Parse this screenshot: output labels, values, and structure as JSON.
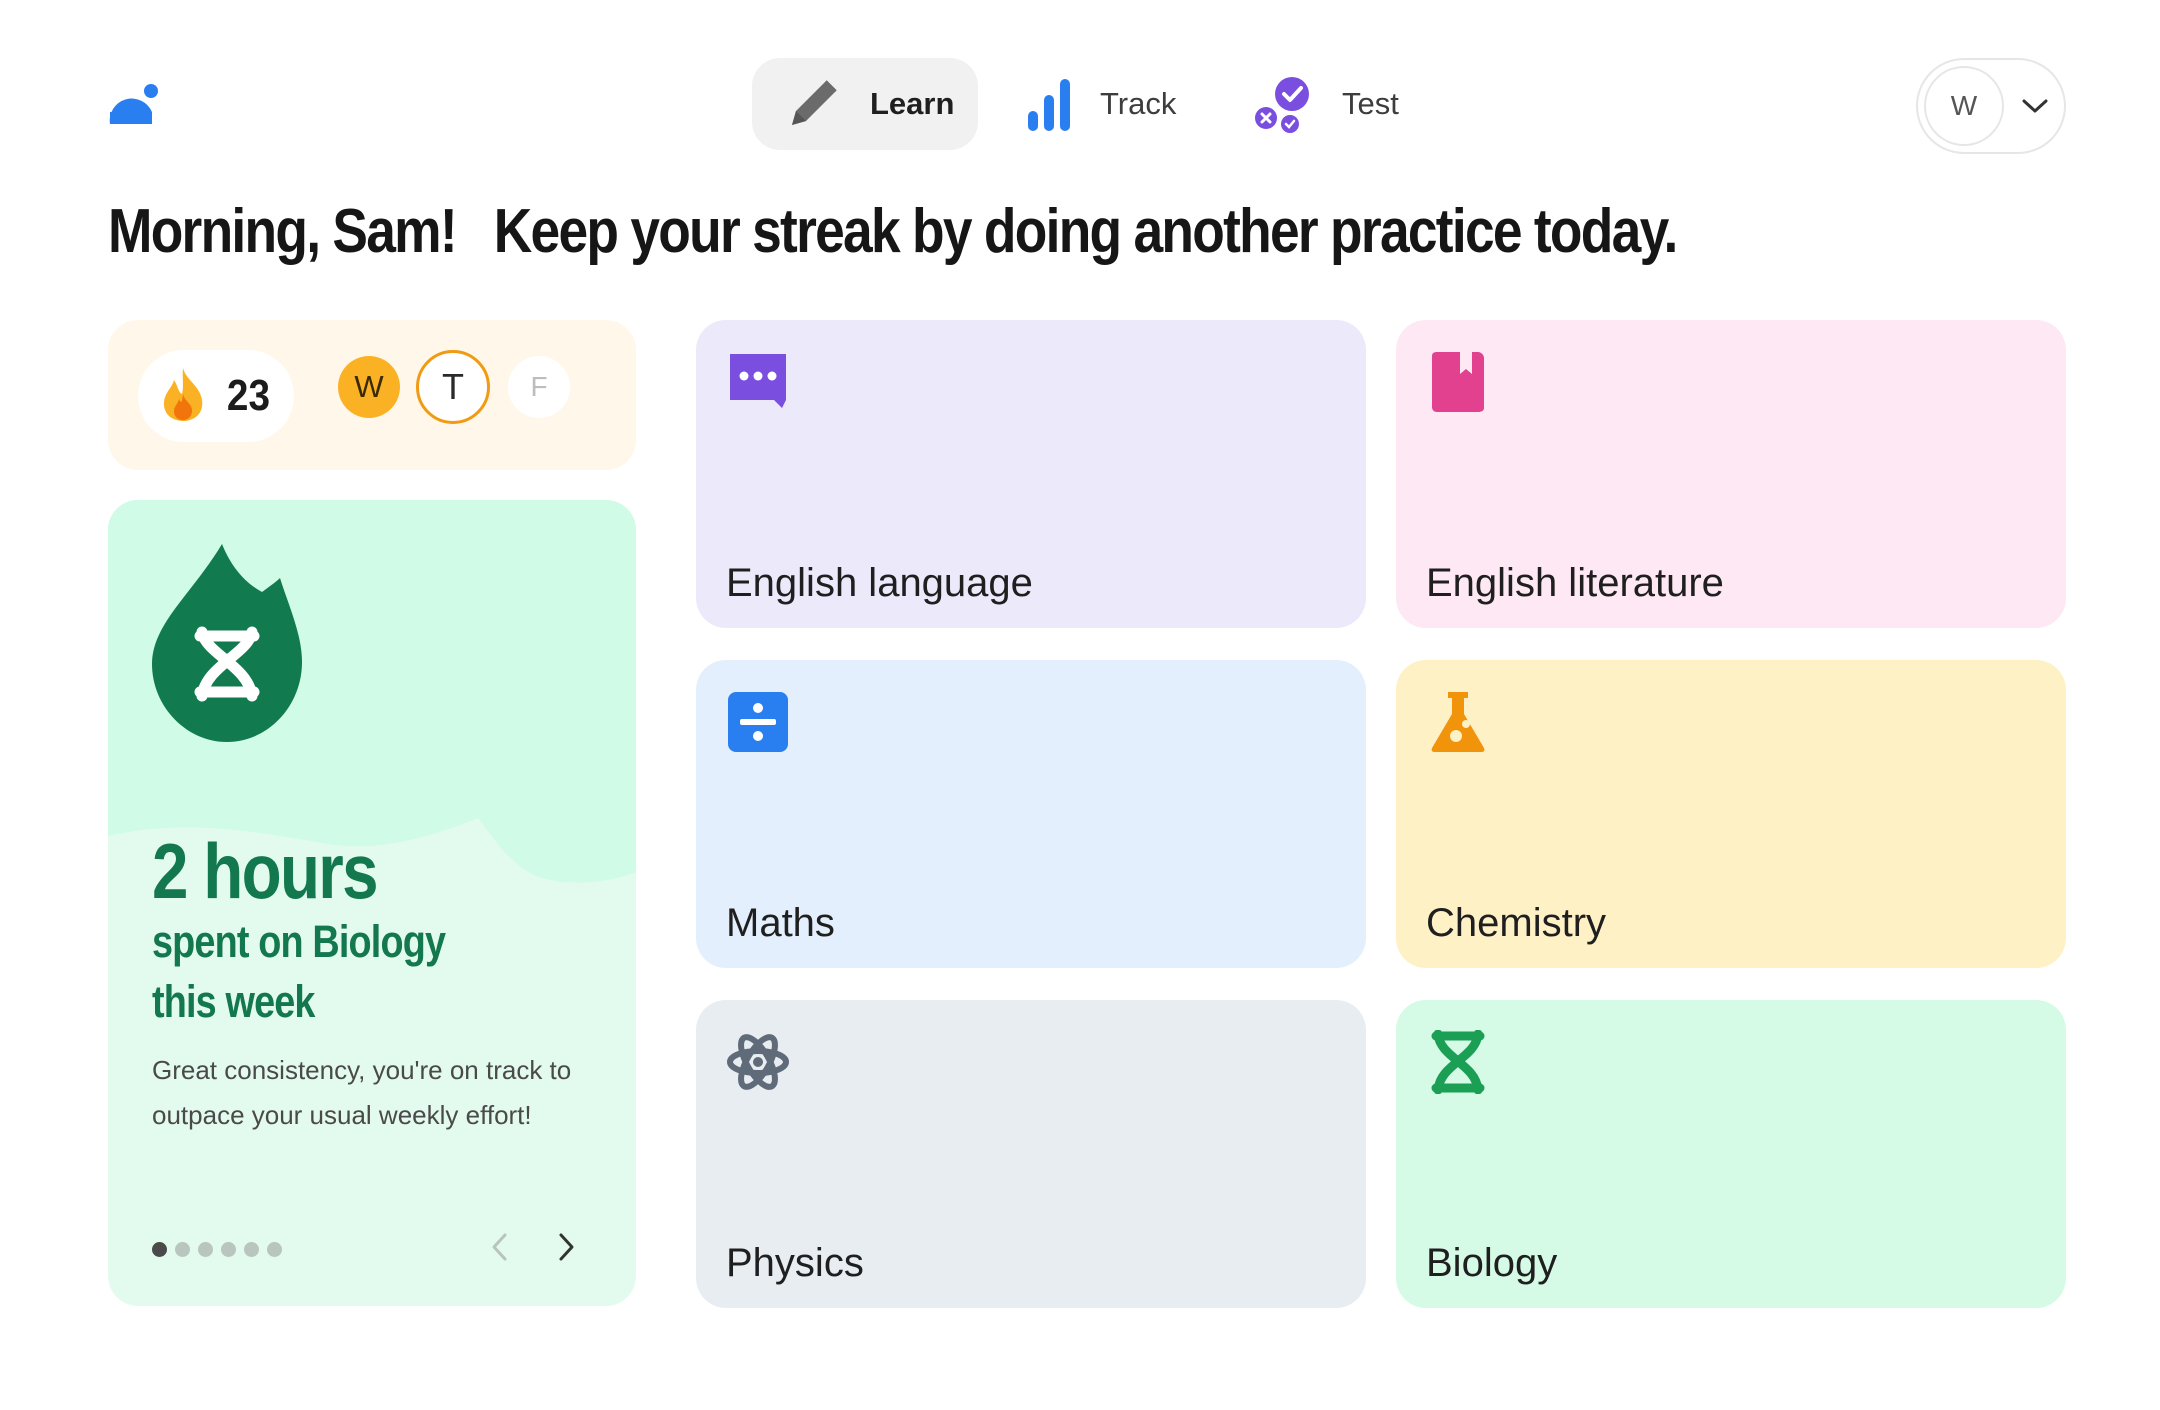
{
  "nav": {
    "items": [
      {
        "label": "Learn",
        "icon": "pencil-icon",
        "active": true
      },
      {
        "label": "Track",
        "icon": "bar-chart-icon",
        "active": false
      },
      {
        "label": "Test",
        "icon": "quiz-check-icon",
        "active": false
      }
    ]
  },
  "user": {
    "initial": "W"
  },
  "heading": {
    "greeting": "Morning, Sam!",
    "message": "Keep your streak by doing another practice today."
  },
  "streak": {
    "count": "23",
    "days": [
      {
        "letter": "W",
        "state": "done"
      },
      {
        "letter": "T",
        "state": "today"
      },
      {
        "letter": "F",
        "state": "future"
      }
    ]
  },
  "progress_card": {
    "icon": "dna-drop-icon",
    "hours": "2 hours",
    "subtitle": "spent on Biology this week",
    "description": "Great consistency, you're on track to outpace your usual weekly effort!",
    "pages": 6,
    "current_page": 1
  },
  "subjects": [
    {
      "label": "English language",
      "icon": "speech-bubble-icon",
      "bg": "#ece9fb",
      "color": "#7a4fe0"
    },
    {
      "label": "English literature",
      "icon": "book-icon",
      "bg": "#fde8f3",
      "color": "#e2418f"
    },
    {
      "label": "Maths",
      "icon": "divide-icon",
      "bg": "#e4effd",
      "color": "#2a7ff0"
    },
    {
      "label": "Chemistry",
      "icon": "flask-icon",
      "bg": "#fff1c6",
      "color": "#f2930c"
    },
    {
      "label": "Physics",
      "icon": "atom-icon",
      "bg": "#e8edf2",
      "color": "#5f6b78"
    },
    {
      "label": "Biology",
      "icon": "dna-icon",
      "bg": "#d5fbe6",
      "color": "#1a9f55"
    }
  ],
  "colors": {
    "brand_blue": "#2a7ff0",
    "streak_bg": "#fff8ea",
    "progress_green": "#13784d",
    "progress_bg": "#e3fbee"
  }
}
